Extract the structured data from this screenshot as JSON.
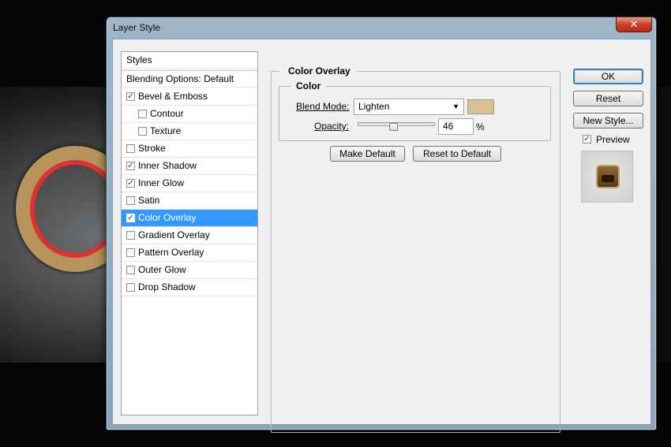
{
  "window": {
    "title": "Layer Style",
    "close_glyph": "✕"
  },
  "styles_list": {
    "header": "Styles",
    "blending_options": "Blending Options: Default",
    "items": [
      {
        "label": "Bevel & Emboss",
        "checked": true,
        "indent": false
      },
      {
        "label": "Contour",
        "checked": false,
        "indent": true
      },
      {
        "label": "Texture",
        "checked": false,
        "indent": true
      },
      {
        "label": "Stroke",
        "checked": false,
        "indent": false
      },
      {
        "label": "Inner Shadow",
        "checked": true,
        "indent": false
      },
      {
        "label": "Inner Glow",
        "checked": true,
        "indent": false
      },
      {
        "label": "Satin",
        "checked": false,
        "indent": false
      },
      {
        "label": "Color Overlay",
        "checked": true,
        "indent": false,
        "selected": true
      },
      {
        "label": "Gradient Overlay",
        "checked": false,
        "indent": false
      },
      {
        "label": "Pattern Overlay",
        "checked": false,
        "indent": false
      },
      {
        "label": "Outer Glow",
        "checked": false,
        "indent": false
      },
      {
        "label": "Drop Shadow",
        "checked": false,
        "indent": false
      }
    ]
  },
  "color_overlay": {
    "group_title": "Color Overlay",
    "subgroup_title": "Color",
    "blend_mode_label": "Blend Mode:",
    "blend_mode_value": "Lighten",
    "overlay_color": "#d8c292",
    "opacity_label": "Opacity:",
    "opacity_value": "46",
    "opacity_unit": "%",
    "opacity_fraction": 0.46,
    "make_default_label": "Make Default",
    "reset_default_label": "Reset to Default"
  },
  "side_buttons": {
    "ok_label": "OK",
    "reset_label": "Reset",
    "new_style_label": "New Style...",
    "preview_label": "Preview",
    "preview_checked": true
  },
  "colors": {
    "selection": "#3399ff",
    "dialog_face": "#f0f0f0"
  }
}
